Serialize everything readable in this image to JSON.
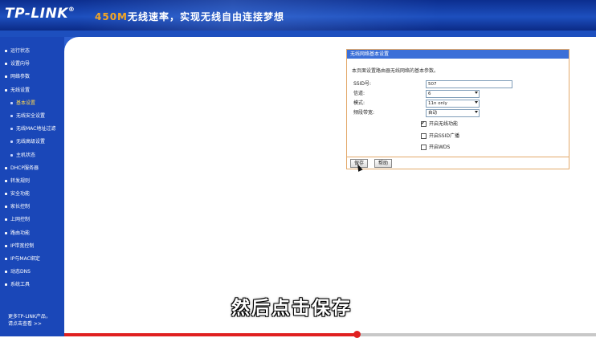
{
  "header": {
    "logo": "TP-LINK",
    "logo_reg": "®",
    "banner_highlight": "450M",
    "banner_text": "无线速率，实现无线自由连接梦想"
  },
  "sidebar": {
    "items": [
      {
        "label": "运行状态",
        "sub": false,
        "active": false
      },
      {
        "label": "设置向导",
        "sub": false,
        "active": false
      },
      {
        "label": "网络参数",
        "sub": false,
        "active": false
      },
      {
        "label": "无线设置",
        "sub": false,
        "active": false
      },
      {
        "label": "基本设置",
        "sub": true,
        "active": true
      },
      {
        "label": "无线安全设置",
        "sub": true,
        "active": false
      },
      {
        "label": "无线MAC地址过滤",
        "sub": true,
        "active": false
      },
      {
        "label": "无线高级设置",
        "sub": true,
        "active": false
      },
      {
        "label": "主机状态",
        "sub": true,
        "active": false
      },
      {
        "label": "DHCP服务器",
        "sub": false,
        "active": false
      },
      {
        "label": "转发规则",
        "sub": false,
        "active": false
      },
      {
        "label": "安全功能",
        "sub": false,
        "active": false
      },
      {
        "label": "家长控制",
        "sub": false,
        "active": false
      },
      {
        "label": "上网控制",
        "sub": false,
        "active": false
      },
      {
        "label": "路由功能",
        "sub": false,
        "active": false
      },
      {
        "label": "IP带宽控制",
        "sub": false,
        "active": false
      },
      {
        "label": "IP与MAC绑定",
        "sub": false,
        "active": false
      },
      {
        "label": "动态DNS",
        "sub": false,
        "active": false
      },
      {
        "label": "系统工具",
        "sub": false,
        "active": false
      }
    ],
    "footer_line1": "更多TP-LINK产品，",
    "footer_line2": "请点击查看 >>"
  },
  "panel": {
    "title": "无线网络基本设置",
    "description": "本页面设置路由器无线网络的基本参数。",
    "ssid_label": "SSID号:",
    "ssid_value": "507",
    "channel_label": "信道:",
    "channel_value": "6",
    "mode_label": "模式:",
    "mode_value": "11n only",
    "bandwidth_label": "频段带宽:",
    "bandwidth_value": "自动",
    "check_wireless": "开启无线功能",
    "check_ssid_broadcast": "开启SSID广播",
    "check_wds": "开启WDS",
    "save_label": "保存",
    "help_label": "帮助"
  },
  "video": {
    "subtitle": "然后点击保存",
    "progress": 0.55
  },
  "colors": {
    "header_blue": "#1d4fbe",
    "sidebar_blue": "#1a47b8",
    "panel_border": "#e3a96a",
    "panel_title": "#3b6fd8",
    "accent_orange": "#f5a623",
    "progress_red": "#e02020"
  }
}
